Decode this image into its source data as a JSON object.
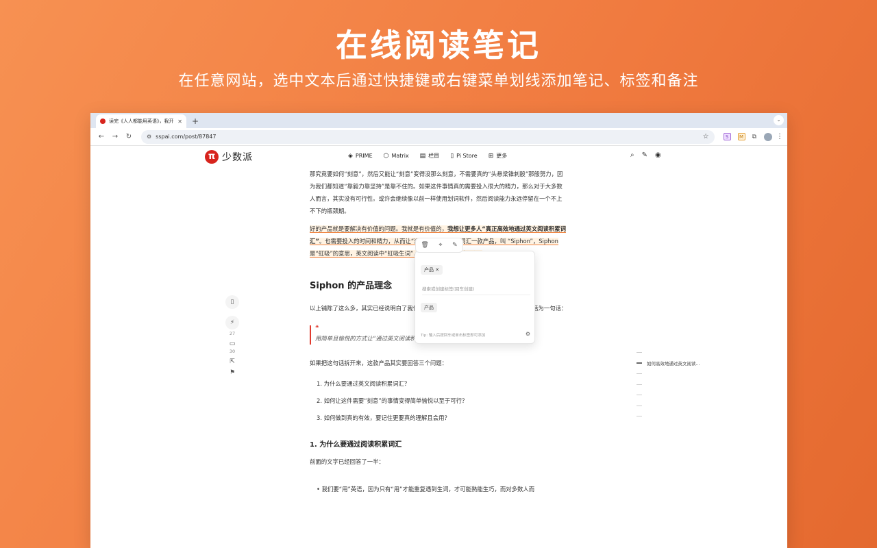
{
  "hero": {
    "title": "在线阅读笔记",
    "subtitle": "在任意网站，选中文本后通过快捷键或右键菜单划线添加笔记、标签和备注"
  },
  "browser": {
    "tab_title": "读完《人人都能用英语》，我开",
    "url": "sspai.com/post/87847",
    "new_tab": "+",
    "close": "✕"
  },
  "site": {
    "logo_mark": "π",
    "logo_name": "少数派",
    "nav": [
      {
        "icon": "◈",
        "label": "PRIME"
      },
      {
        "icon": "⬡",
        "label": "Matrix"
      },
      {
        "icon": "▤",
        "label": "栏目"
      },
      {
        "icon": "▯",
        "label": "Pi Store"
      },
      {
        "icon": "⊞",
        "label": "更多"
      }
    ]
  },
  "article": {
    "p1": "那究竟要如何“刻意”，然后又能让“刻意”变得没那么刻意，不需要真的“头悬梁锥刺股”那般努力，因为我们都知道“靠毅力靠坚持”是靠不住的。如果这件事情真的需要投入很大的精力，那么对于大多数人而言，其实没有可行性。或许会继续像以前一样使用划词软件，然后阅读能力永远停留在一个不上不下的瓶颈期。",
    "p2_a": "好的产品就是要解决有价值的问题。我",
    "p2_b": "就是有价值的，",
    "p2_bold": "我想让更多人“真正高效地通过英文阅读积累词汇”",
    "p2_c": "。也需要",
    "p2_d": "投入的时间和精力，从而让“通过英文阅读积累词汇",
    "p2_e": "一款产品，叫 “Siphon”，Siphon 是“虹吸”的意思，",
    "p2_f": "英文阅读中“虹吸生词”，所以她的中文名叫“吸词”",
    "h2": "Siphon 的产品理念",
    "p3": "以上铺陈了这么多，其实已经说明白了我做 Siphon 的初衷，Siphon 的产品理念可以概括为一句话：",
    "quote_mark": "❝",
    "quote": "用简单且愉悦的方式让“通过英文阅读积累词汇”这件事变得可行且有效",
    "p4": "如果把这句话拆开来，这款产品其实要回答三个问题：",
    "questions": [
      "1. 为什么要通过英文阅读积累词汇？",
      "2. 如何让这件需要“刻意”的事情变得简单愉悦以至于可行？",
      "3. 如何做到真的有效，要记住更要真的理解且会用？"
    ],
    "h3": "1. 为什么要通过阅读积累词汇",
    "p5": "前面的文字已经回答了一半：",
    "bullet": "• 我们要“用”英语，因为只有“用”才能重复遇到生词，才可能熟能生巧，而对多数人而"
  },
  "popup": {
    "tool_icons": [
      "🗑",
      "⌖",
      "✎"
    ],
    "tag_chip": "产品 ✕",
    "search_placeholder": "搜索或创建标签(回车创建)",
    "suggest_chip": "产品",
    "tip": "Tip: 输入后按回车或单击标签即可添加",
    "gear": "⚙"
  },
  "rail": {
    "likes": "27",
    "comments": "30"
  },
  "toc": {
    "active_item": "如何高效地通过英文阅读..."
  }
}
